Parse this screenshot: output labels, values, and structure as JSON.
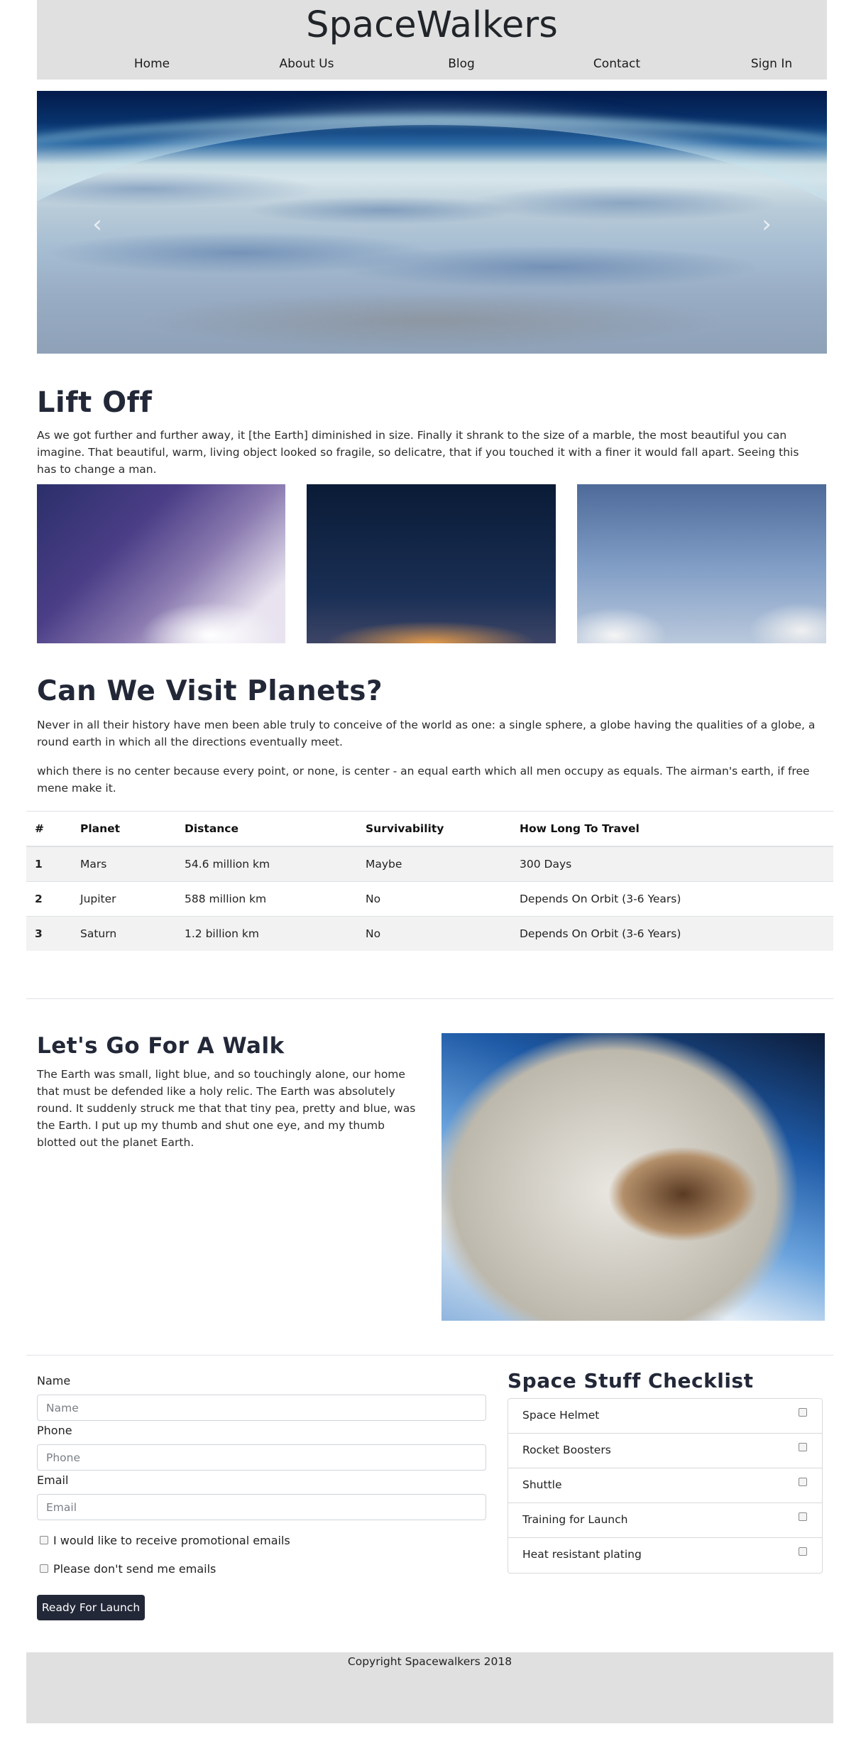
{
  "brand": "SpaceWalkers",
  "nav": [
    "Home",
    "About Us",
    "Blog",
    "Contact",
    "Sign In"
  ],
  "carousel": {
    "prev_icon": "chevron-left-icon",
    "next_icon": "chevron-right-icon"
  },
  "lift_off": {
    "title": "Lift Off",
    "text": "As we got further and further away, it [the Earth] diminished in size. Finally it shrank to the size of a marble, the most beautiful you can imagine. That beautiful, warm, living object looked so fragile, so delicatre, that if you touched it with a finer it would fall apart. Seeing this has to change a man."
  },
  "planets": {
    "title": "Can We Visit Planets?",
    "p1": "Never in all their history have men been able truly to conceive of the world as one: a single sphere, a globe having the qualities of a globe, a round earth in which all the directions eventually meet.",
    "p2": "which there is no center because every point, or none, is center - an equal earth which all men occupy as equals. The airman's earth, if free mene make it.",
    "headers": [
      "#",
      "Planet",
      "Distance",
      "Survivability",
      "How Long To Travel"
    ],
    "rows": [
      [
        "1",
        "Mars",
        "54.6 million km",
        "Maybe",
        "300 Days"
      ],
      [
        "2",
        "Jupiter",
        "588 million km",
        "No",
        "Depends On Orbit (3-6 Years)"
      ],
      [
        "3",
        "Saturn",
        "1.2 billion km",
        "No",
        "Depends On Orbit (3-6 Years)"
      ]
    ]
  },
  "walk": {
    "title": "Let's Go For A Walk",
    "text": "The Earth was small, light blue, and so touchingly alone, our home that must be defended like a holy relic. The Earth was absolutely round. It suddenly struck me that that tiny pea, pretty and blue, was the Earth. I put up my thumb and shut one eye, and my thumb blotted out the planet Earth."
  },
  "form": {
    "name_label": "Name",
    "name_placeholder": "Name",
    "phone_label": "Phone",
    "phone_placeholder": "Phone",
    "email_label": "Email",
    "email_placeholder": "Email",
    "opt_in": "I would like to receive promotional emails",
    "opt_out": "Please don't send me emails",
    "submit": "Ready For Launch"
  },
  "checklist": {
    "title": "Space Stuff Checklist",
    "items": [
      "Space Helmet",
      "Rocket Boosters",
      "Shuttle",
      "Training for Launch",
      "Heat resistant plating"
    ]
  },
  "footer": "Copyright Spacewalkers 2018",
  "colors": {
    "dark": "#232838",
    "header_bg": "#e0e0e0",
    "stripe": "#f2f2f2"
  }
}
